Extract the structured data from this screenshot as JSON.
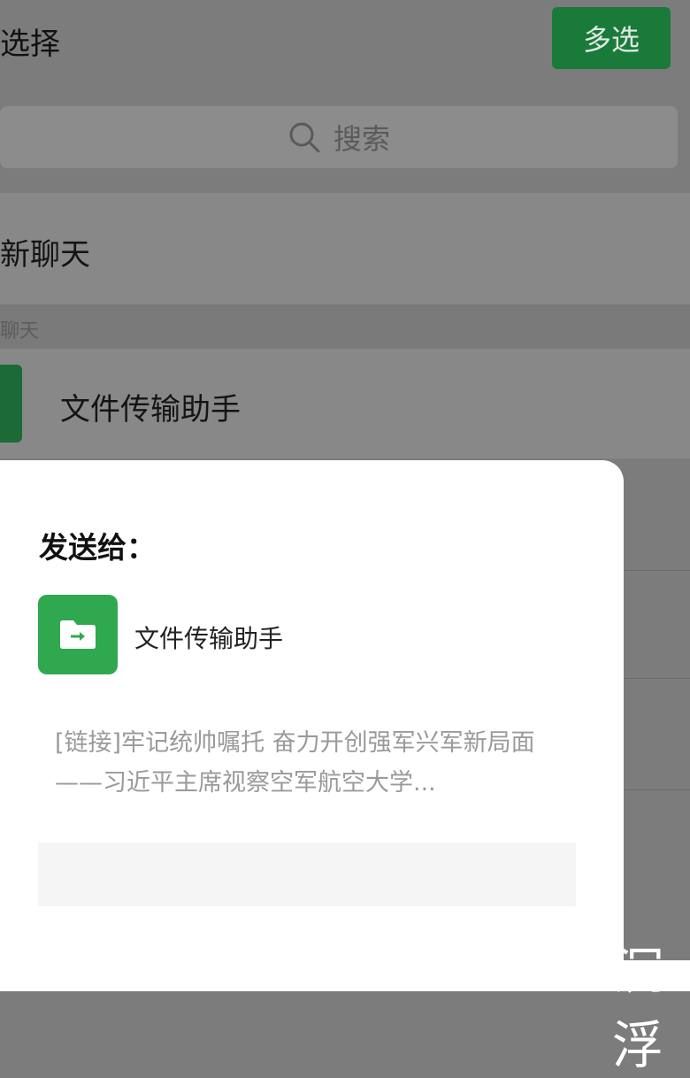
{
  "header": {
    "title": "选择",
    "multi_select_label": "多选"
  },
  "search": {
    "placeholder": "搜索"
  },
  "list": {
    "new_chat_label": "新聊天",
    "section_label": "聊天",
    "items": [
      {
        "name": "文件传输助手"
      }
    ]
  },
  "dialog": {
    "title": "发送给：",
    "recipient": "文件传输助手",
    "message_preview": "[链接]牢记统帅嘱托 奋力开创强军兴军新局面——习近平主席视察空军航空大学...",
    "input_value": ""
  },
  "watermark": "沉浮",
  "colors": {
    "accent": "#2fa84f",
    "dim_accent": "#1a7a3a",
    "overlay": "#7c7c7c"
  }
}
